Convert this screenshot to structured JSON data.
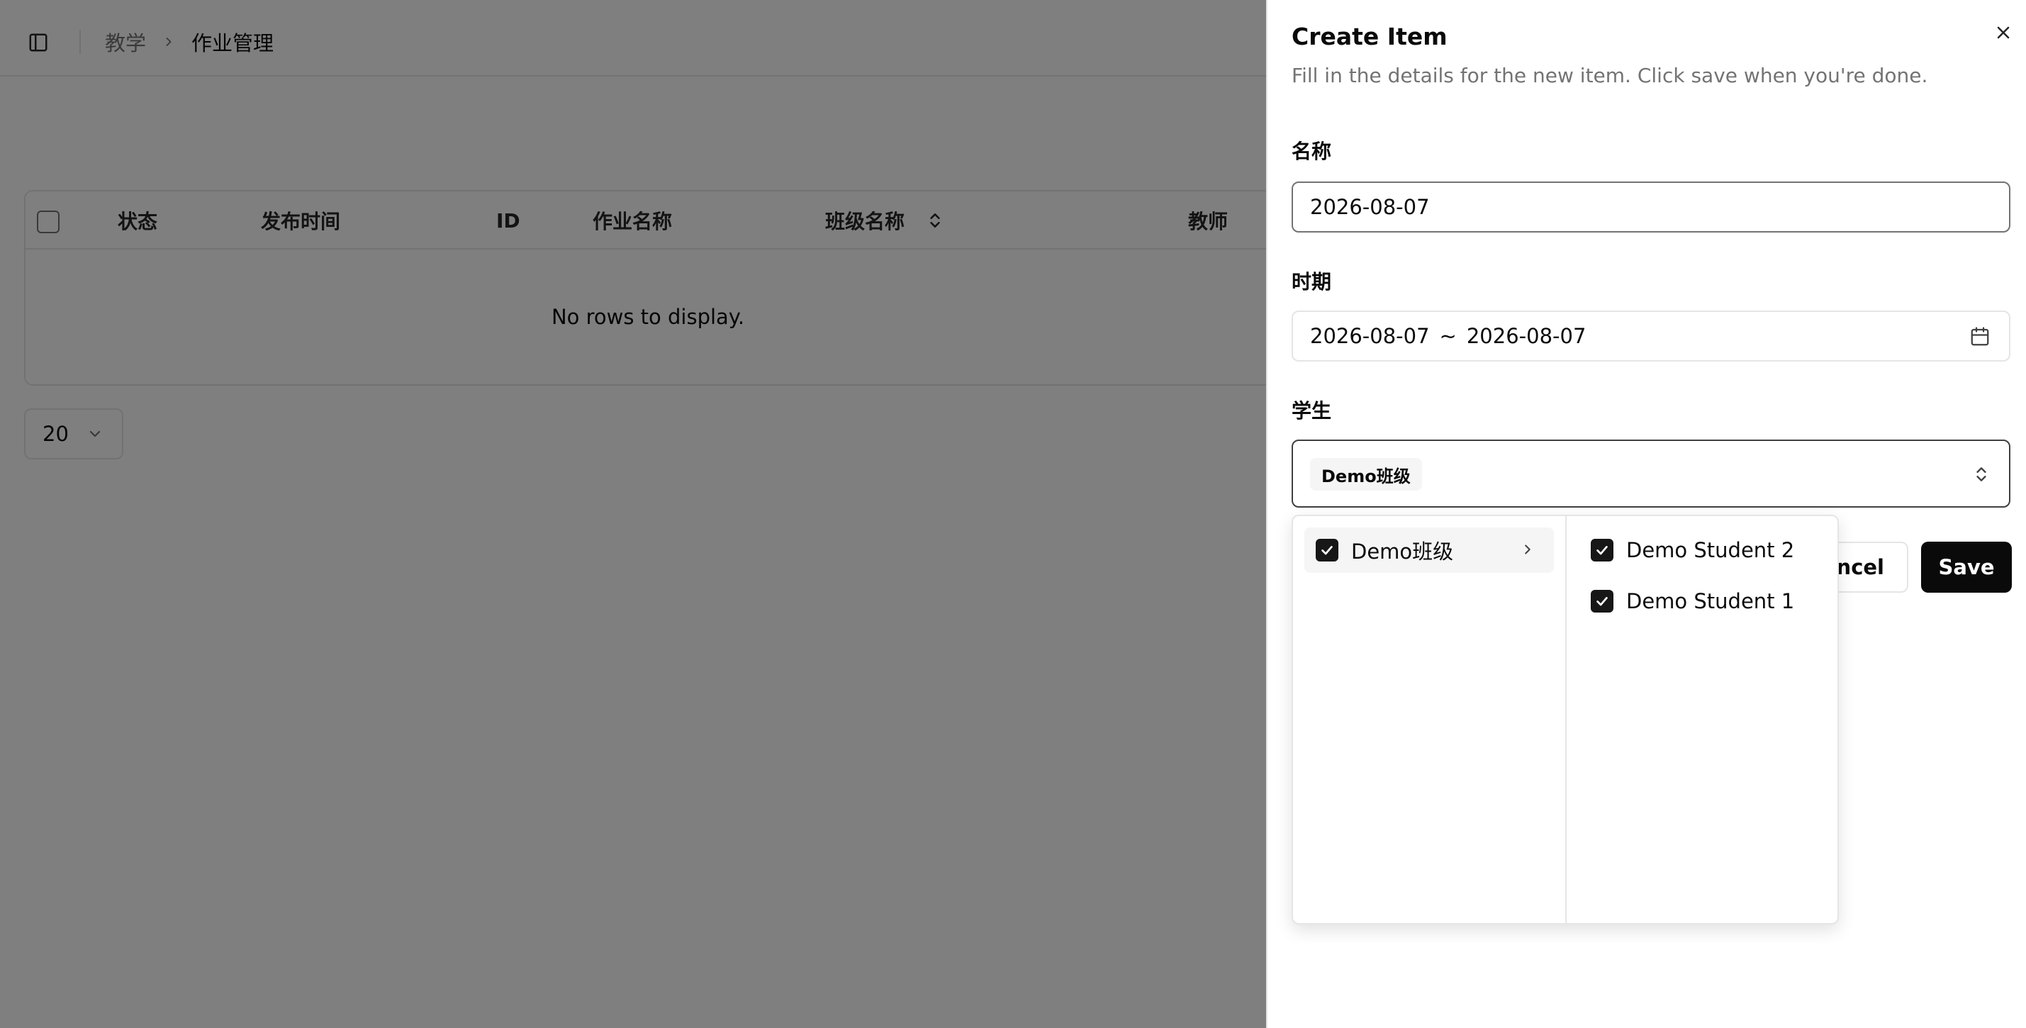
{
  "breadcrumb": {
    "parent": "教学",
    "current": "作业管理"
  },
  "table": {
    "columns": [
      "状态",
      "发布时间",
      "ID",
      "作业名称",
      "班级名称",
      "教师"
    ],
    "empty_text": "No rows to display."
  },
  "pagination": {
    "page_size": "20"
  },
  "sheet": {
    "title": "Create Item",
    "description": "Fill in the details for the new item. Click save when you're done.",
    "name_label": "名称",
    "name_value": "2026-08-07",
    "period_label": "时期",
    "period_start": "2026-08-07",
    "period_separator": "~",
    "period_end": "2026-08-07",
    "students_label": "学生",
    "students_tag": "Demo班级",
    "cancel_label": "ancel",
    "save_label": "Save"
  },
  "cascader": {
    "groups": [
      {
        "label": "Demo班级",
        "checked": true
      }
    ],
    "options": [
      {
        "label": "Demo Student 2",
        "checked": true
      },
      {
        "label": "Demo Student 1",
        "checked": true
      }
    ]
  },
  "colors": {
    "primary": "#0a0a0a",
    "muted": "#737373",
    "border": "#e5e5e5"
  }
}
